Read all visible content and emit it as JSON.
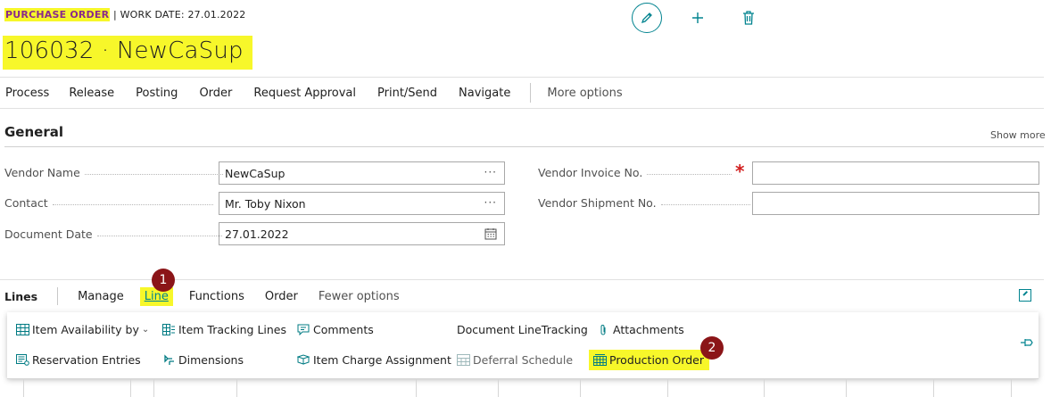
{
  "header": {
    "page_type": "PURCHASE ORDER",
    "work_date": "| WORK DATE: 27.01.2022",
    "title": "106032 · NewCaSup",
    "icons": [
      "edit-icon",
      "add-icon",
      "delete-icon"
    ]
  },
  "actionbar": {
    "items": [
      "Process",
      "Release",
      "Posting",
      "Order",
      "Request Approval",
      "Print/Send",
      "Navigate"
    ],
    "more": "More options"
  },
  "general": {
    "title": "General",
    "show_more": "Show more",
    "fields": {
      "vendor_name": {
        "label": "Vendor Name",
        "value": "NewCaSup"
      },
      "contact": {
        "label": "Contact",
        "value": "Mr. Toby Nixon"
      },
      "document_date": {
        "label": "Document Date",
        "value": "27.01.2022"
      },
      "vendor_invoice_no": {
        "label": "Vendor Invoice No.",
        "value": "",
        "required_marker": "*"
      },
      "vendor_shipment_no": {
        "label": "Vendor Shipment No.",
        "value": ""
      }
    },
    "assist": "···"
  },
  "lines": {
    "title": "Lines",
    "tabs": [
      "Manage",
      "Line",
      "Functions",
      "Order"
    ],
    "active_tab": "Line",
    "fewer": "Fewer options",
    "badges": [
      "1",
      "2"
    ],
    "menu": {
      "row1": [
        "Item Availability by",
        "Item Tracking Lines",
        "Comments",
        "Document LineTracking",
        "Attachments"
      ],
      "row2": [
        "Reservation Entries",
        "Dimensions",
        "Item Charge Assignment",
        "Deferral Schedule",
        "Production Order"
      ]
    }
  },
  "colors": {
    "accent": "#00838f",
    "highlight": "#f7f72a",
    "badge": "#8b1518",
    "required": "#d21f1f"
  }
}
